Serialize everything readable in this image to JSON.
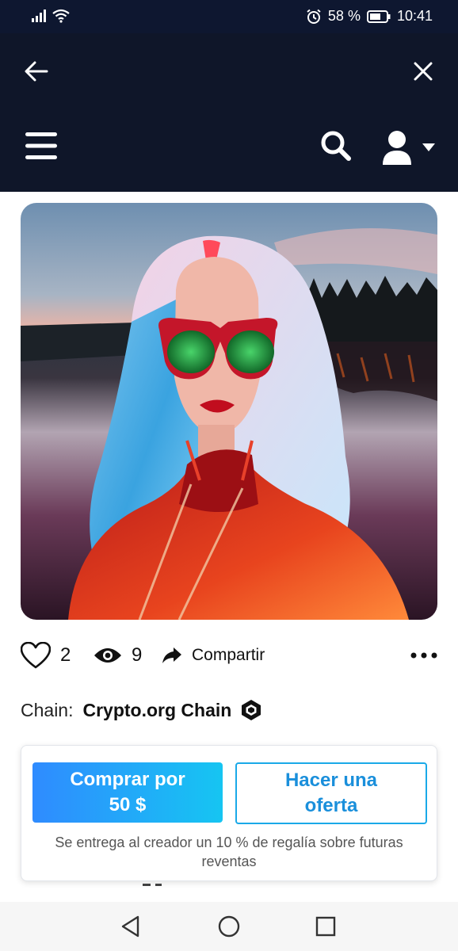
{
  "status": {
    "battery": "58 %",
    "time": "10:41"
  },
  "header": {
    "back_icon": "arrow-left-icon",
    "close_icon": "close-icon",
    "menu_icon": "hamburger-menu-icon",
    "search_icon": "search-icon",
    "user_icon": "user-avatar-icon"
  },
  "artwork": {
    "alt": "Portrait of a woman with long blue hair, red-framed green sunglasses and a shiny red jacket by a lake at sunset"
  },
  "stats": {
    "likes": "2",
    "views": "9",
    "share_label": "Compartir"
  },
  "chain": {
    "label": "Chain:",
    "value": "Crypto.org Chain"
  },
  "purchase": {
    "buy_label_line1": "Comprar por",
    "buy_label_line2": "50 $",
    "offer_label_line1": "Hacer una",
    "offer_label_line2": "oferta",
    "royalty_note": "Se entrega al creador un 10 % de regalía sobre futuras reventas"
  },
  "colors": {
    "header_bg": "#0f1629",
    "accent": "#1aa9e8",
    "buy_gradient_start": "#2f8bff",
    "buy_gradient_end": "#16c5f2"
  }
}
